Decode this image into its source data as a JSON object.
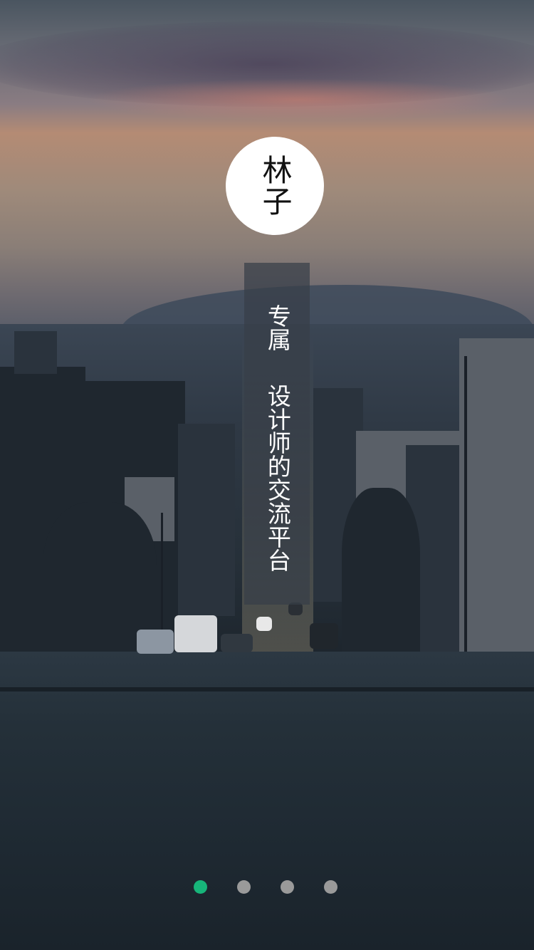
{
  "logo": {
    "text": "林子"
  },
  "banner": {
    "line1": "专属",
    "line2": "设计师的交流平台"
  },
  "pager": {
    "count": 4,
    "active_index": 0,
    "active_color": "#17b57a",
    "inactive_color": "#9a9a9a"
  }
}
